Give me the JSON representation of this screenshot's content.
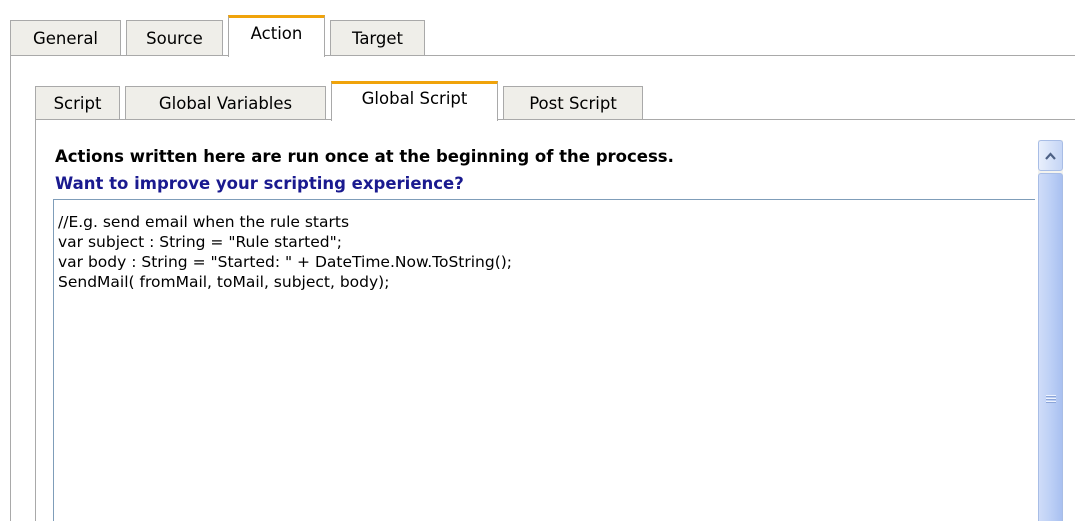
{
  "outer_tabs": {
    "general": "General",
    "source": "Source",
    "action": "Action",
    "target": "Target"
  },
  "inner_tabs": {
    "script": "Script",
    "global_variables": "Global Variables",
    "global_script": "Global Script",
    "post_script": "Post Script"
  },
  "panel": {
    "info_text": "Actions written here are run once at the beginning of the process.",
    "improve_link": "Want to improve your scripting experience?"
  },
  "editor": {
    "lines": [
      "//E.g. send email when the rule starts",
      "var subject : String = \"Rule started\";",
      "var body : String = \"Started: \" + DateTime.Now.ToString();",
      "SendMail( fromMail, toMail, subject, body);"
    ]
  },
  "colors": {
    "active_tab_accent": "#f0a30a",
    "link": "#1a1a8f",
    "scrollbar": "#b9cdf5"
  },
  "icons": {
    "scroll_up": "chevron-up-icon",
    "scroll_grip": "grip-lines-icon"
  }
}
